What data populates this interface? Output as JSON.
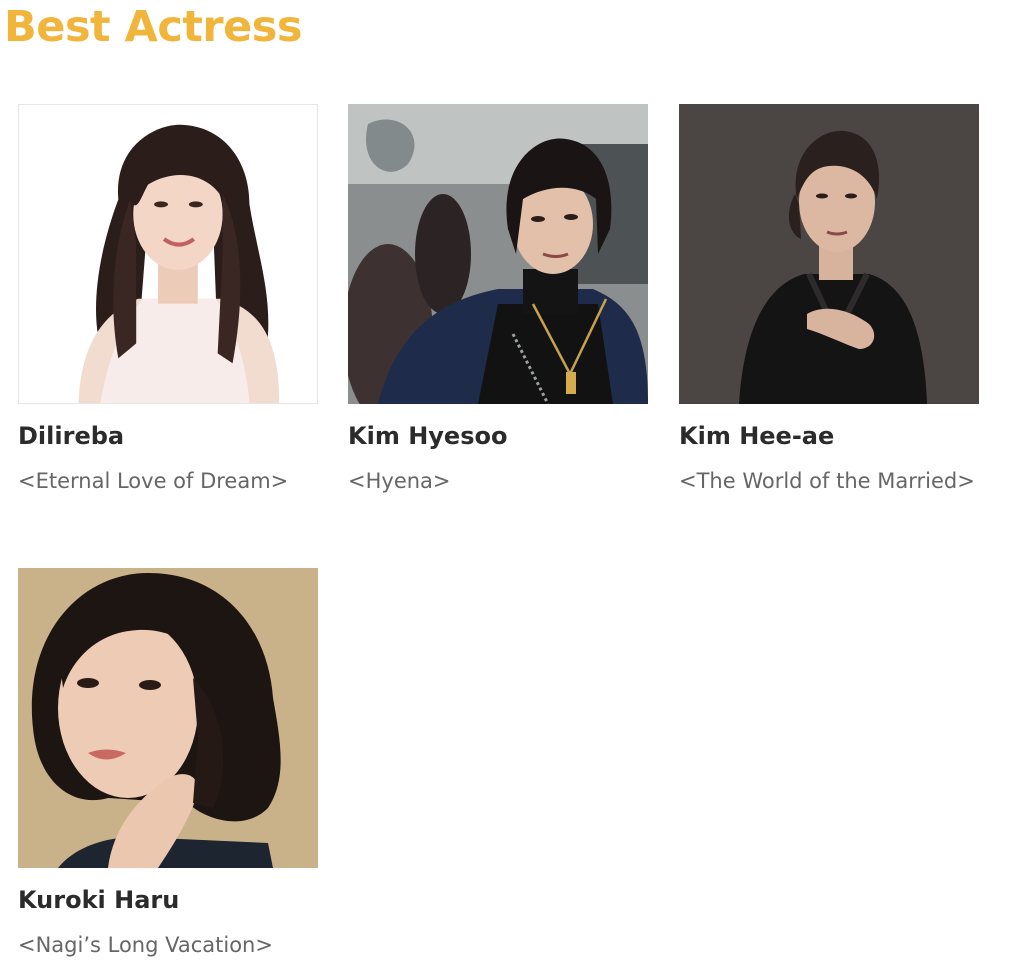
{
  "section": {
    "title": "Best Actress",
    "accent_color": "#f0b53a"
  },
  "actresses": [
    {
      "name": "Dilireba",
      "work": "<Eternal Love of Dream>",
      "photo": "portrait-white-background"
    },
    {
      "name": "Kim Hyesoo",
      "work": "<Hyena>",
      "photo": "portrait-short-hair-navy-blazer"
    },
    {
      "name": "Kim Hee-ae",
      "work": "<The World of the Married>",
      "photo": "portrait-dark-background-black-jacket"
    },
    {
      "name": "Kuroki Haru",
      "work": "<Nagi’s Long Vacation>",
      "photo": "portrait-beige-background-wavy-hair"
    }
  ]
}
